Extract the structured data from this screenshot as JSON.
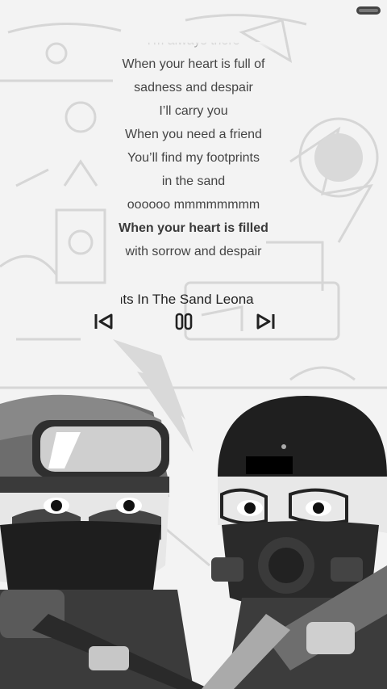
{
  "lyrics": {
    "lines": [
      "I'm always there",
      "When your heart is full of",
      "sadness and despair",
      "I’ll carry you",
      "When you need a friend",
      "You’ll find my footprints",
      "in the sand",
      "oooooo mmmmmmmm",
      "When your heart is filled",
      "with sorrow and despair"
    ],
    "active_index": 8
  },
  "player": {
    "title": "Footprints In The Sand   Leona Lewis",
    "visible_title": "tprints In The Sand   Le"
  },
  "icons": {
    "prev": "skip-previous-icon",
    "pause": "pause-icon",
    "next": "skip-next-icon"
  },
  "colors": {
    "background": "#f3f3f3",
    "text": "#444444",
    "icon": "#222222"
  }
}
